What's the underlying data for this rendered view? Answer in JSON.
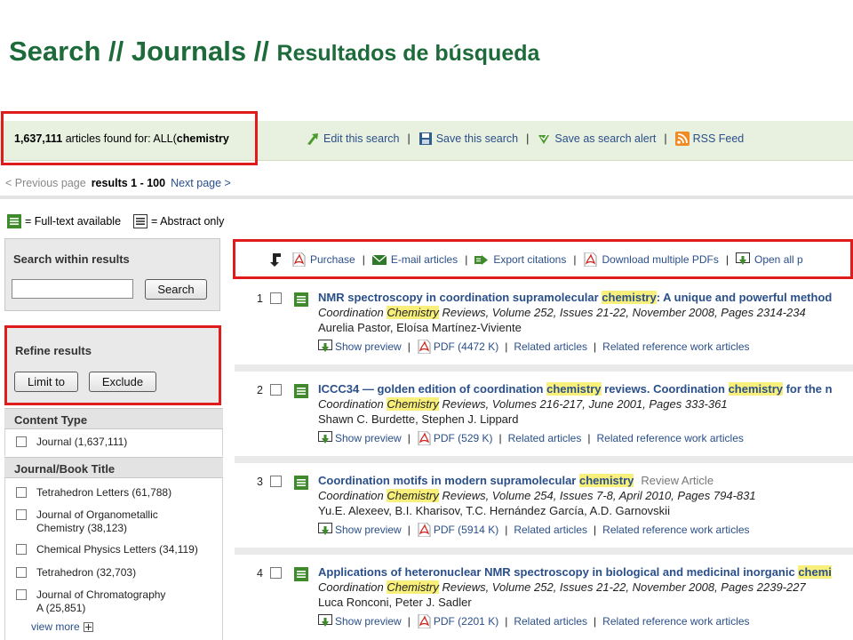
{
  "slide_title": {
    "part1": "Search // Journals // ",
    "part2": "Resultados de búsqueda"
  },
  "search_header": {
    "count": "1,637,111",
    "found_text": " articles found for: ALL(",
    "query": "chemistry",
    "actions": [
      "Edit this search",
      "Save this search",
      "Save as search alert",
      "RSS Feed"
    ]
  },
  "pager": {
    "previous": "< Previous page",
    "results": "results 1 - 100",
    "next": "Next page >"
  },
  "legend": {
    "fulltext": "= Full-text available",
    "abstract": "= Abstract only"
  },
  "search_within": {
    "title": "Search within results",
    "input_value": "",
    "button": "Search"
  },
  "refine": {
    "title": "Refine results",
    "limit_to": "Limit to",
    "exclude": "Exclude"
  },
  "content_type": {
    "title": "Content Type",
    "items": [
      "Journal (1,637,111)"
    ]
  },
  "journal_title": {
    "title": "Journal/Book Title",
    "items": [
      "Tetrahedron Letters (61,788)",
      "Journal of Organometallic",
      "Chemistry (38,123)",
      "Chemical Physics Letters (34,119)",
      "Tetrahedron (32,703)",
      "Journal of Chromatography",
      "A (25,851)"
    ],
    "view_more": "view more"
  },
  "toolbar": [
    "Purchase",
    "E-mail articles",
    "Export citations",
    "Download multiple PDFs",
    "Open all p"
  ],
  "results": [
    {
      "num": "1",
      "title_a": "NMR spectroscopy in coordination supramolecular ",
      "title_hl": "chemistry",
      "title_b": ": A unique and powerful method",
      "title_hl2": "",
      "title_c": "",
      "review": "",
      "src_a": "Coordination ",
      "src_hl": "Chemistry",
      "src_b": " Reviews, Volume 252, Issues 21-22, November 2008, Pages 2314-234",
      "authors": "Aurelia Pastor, Eloísa Martínez-Viviente",
      "pdf": "PDF (4472 K)"
    },
    {
      "num": "2",
      "title_a": "ICCC34 — golden edition of coordination ",
      "title_hl": "chemistry",
      "title_b": " reviews. Coordination ",
      "title_hl2": "chemistry",
      "title_c": " for the n",
      "review": "",
      "src_a": "Coordination ",
      "src_hl": "Chemistry",
      "src_b": " Reviews, Volumes 216-217, June 2001, Pages 333-361",
      "authors": "Shawn C. Burdette, Stephen J. Lippard",
      "pdf": "PDF (529 K)"
    },
    {
      "num": "3",
      "title_a": "Coordination motifs in modern supramolecular ",
      "title_hl": "chemistry",
      "title_b": "",
      "title_hl2": "",
      "title_c": "",
      "review": "Review Article",
      "src_a": "Coordination ",
      "src_hl": "Chemistry",
      "src_b": " Reviews, Volume 254, Issues 7-8, April 2010, Pages 794-831",
      "authors": "Yu.E. Alexeev, B.I. Kharisov, T.C. Hernández García, A.D. Garnovskii",
      "pdf": "PDF (5914 K)"
    },
    {
      "num": "4",
      "title_a": "Applications of heteronuclear NMR spectroscopy in biological and medicinal inorganic ",
      "title_hl": "chemi",
      "title_b": "",
      "title_hl2": "",
      "title_c": "",
      "review": "",
      "src_a": "Coordination ",
      "src_hl": "Chemistry",
      "src_b": " Reviews, Volume 252, Issues 21-22, November 2008, Pages 2239-227",
      "authors": "Luca Ronconi, Peter J. Sadler",
      "pdf": "PDF (2201 K)"
    }
  ],
  "result_links": {
    "preview": "Show preview",
    "related": "Related articles",
    "related_ref": "Related reference work articles"
  },
  "colors": {
    "title_green": "#1d6b3a",
    "link_blue": "#2a4f8a",
    "highlight": "#f8f07a",
    "annotation_red": "#e01b1b"
  }
}
